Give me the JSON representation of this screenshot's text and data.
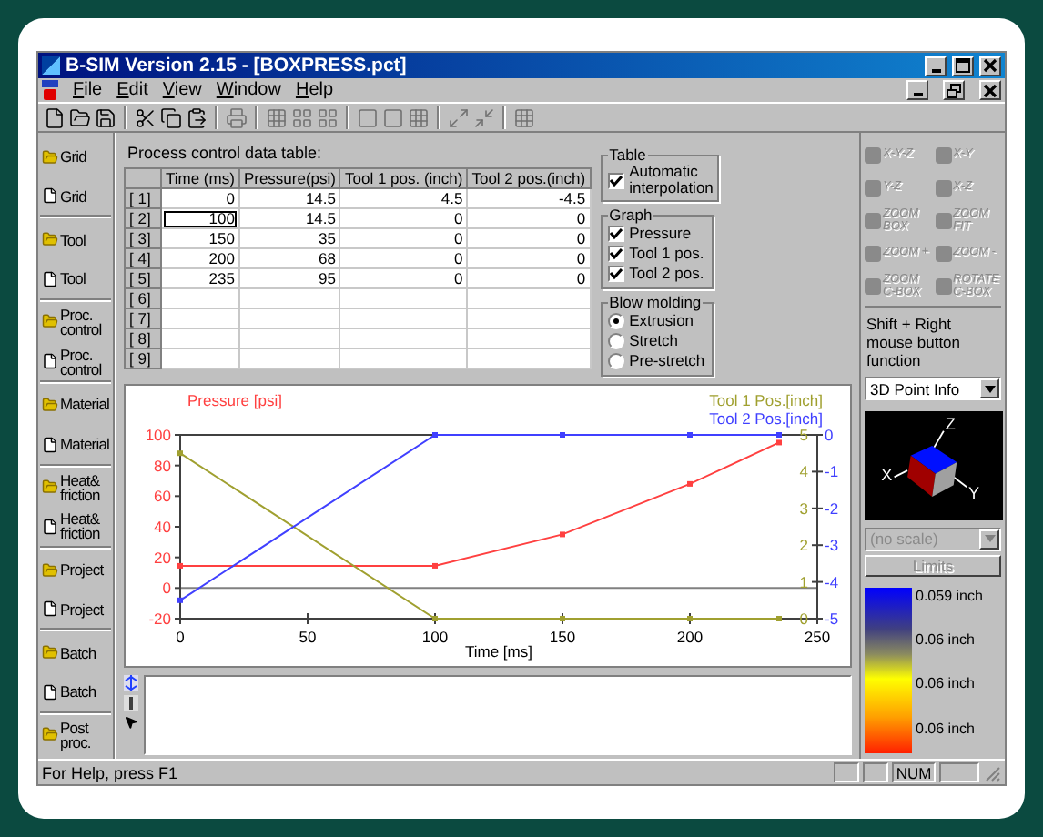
{
  "window": {
    "title": "B-SIM Version 2.15 - [BOXPRESS.pct]"
  },
  "menu": [
    "File",
    "Edit",
    "View",
    "Window",
    "Help"
  ],
  "sidebar": [
    {
      "label": "Grid",
      "kind": "open"
    },
    {
      "label": "Grid",
      "kind": "new"
    },
    {
      "label": "Tool",
      "kind": "open"
    },
    {
      "label": "Tool",
      "kind": "new"
    },
    {
      "label": "Proc. control",
      "kind": "open"
    },
    {
      "label": "Proc. control",
      "kind": "new"
    },
    {
      "label": "Material",
      "kind": "open"
    },
    {
      "label": "Material",
      "kind": "new"
    },
    {
      "label": "Heat& friction",
      "kind": "open"
    },
    {
      "label": "Heat& friction",
      "kind": "new"
    },
    {
      "label": "Project",
      "kind": "open"
    },
    {
      "label": "Project",
      "kind": "new"
    },
    {
      "label": "Batch",
      "kind": "open"
    },
    {
      "label": "Batch",
      "kind": "new"
    },
    {
      "label": "Post proc.",
      "kind": "open"
    }
  ],
  "table": {
    "title": "Process control data table:",
    "columns": [
      "Time (ms)",
      "Pressure(psi)",
      "Tool 1 pos. (inch)",
      "Tool 2 pos.(inch)"
    ],
    "rows": [
      {
        "label": "[ 1]",
        "cells": [
          {
            "text": "0",
            "focused": false
          },
          {
            "text": "14.5",
            "focused": false
          },
          {
            "text": "4.5",
            "focused": false
          },
          {
            "text": "-4.5",
            "focused": false
          }
        ]
      },
      {
        "label": "[ 2]",
        "cells": [
          {
            "text": "100",
            "focused": true
          },
          {
            "text": "14.5",
            "focused": false
          },
          {
            "text": "0",
            "focused": false
          },
          {
            "text": "0",
            "focused": false
          }
        ]
      },
      {
        "label": "[ 3]",
        "cells": [
          {
            "text": "150",
            "focused": false
          },
          {
            "text": "35",
            "focused": false
          },
          {
            "text": "0",
            "focused": false
          },
          {
            "text": "0",
            "focused": false
          }
        ]
      },
      {
        "label": "[ 4]",
        "cells": [
          {
            "text": "200",
            "focused": false
          },
          {
            "text": "68",
            "focused": false
          },
          {
            "text": "0",
            "focused": false
          },
          {
            "text": "0",
            "focused": false
          }
        ]
      },
      {
        "label": "[ 5]",
        "cells": [
          {
            "text": "235",
            "focused": false
          },
          {
            "text": "95",
            "focused": false
          },
          {
            "text": "0",
            "focused": false
          },
          {
            "text": "0",
            "focused": false
          }
        ]
      },
      {
        "label": "[ 6]",
        "cells": []
      },
      {
        "label": "[ 7]",
        "cells": []
      },
      {
        "label": "[ 8]",
        "cells": []
      },
      {
        "label": "[ 9]",
        "cells": []
      }
    ]
  },
  "groups": [
    {
      "title": "Table",
      "items": [
        {
          "kind": "checkbox",
          "label": "Automatic interpolation",
          "checked": true
        }
      ]
    },
    {
      "title": "Graph",
      "items": [
        {
          "kind": "checkbox",
          "label": "Pressure",
          "checked": true
        },
        {
          "kind": "checkbox",
          "label": "Tool 1 pos.",
          "checked": true
        },
        {
          "kind": "checkbox",
          "label": "Tool 2 pos.",
          "checked": true
        }
      ]
    },
    {
      "title": "Blow molding",
      "items": [
        {
          "kind": "radio",
          "label": "Extrusion",
          "selected": true
        },
        {
          "kind": "radio",
          "label": "Stretch",
          "selected": false
        },
        {
          "kind": "radio",
          "label": "Pre-stretch",
          "selected": false
        }
      ]
    }
  ],
  "chart": {
    "chart_data": {
      "type": "line",
      "xlabel": "Time [ms]",
      "x": [
        0,
        100,
        150,
        200,
        235
      ],
      "xlim": [
        0,
        250
      ],
      "ylim": [
        -20,
        100
      ],
      "xticks": [
        0,
        50,
        100,
        150,
        200,
        250
      ],
      "yticks": [
        -20,
        0,
        20,
        40,
        60,
        80,
        100
      ],
      "series": [
        {
          "name": "Pressure [psi]",
          "color": "#ff4040",
          "marker": "square",
          "values": [
            14.5,
            14.5,
            35,
            68,
            95
          ]
        },
        {
          "name": "Tool 1 Pos.[inch]",
          "color": "#a0a030",
          "marker": "square",
          "axis": "y2",
          "values": [
            4.5,
            0,
            0,
            0,
            0
          ]
        },
        {
          "name": "Tool 2 Pos.[inch]",
          "color": "#4040ff",
          "marker": "square",
          "axis": "y3",
          "values": [
            -4.5,
            0,
            0,
            0,
            0
          ]
        }
      ],
      "y2lim": [
        0,
        5
      ],
      "y2ticks": [
        0,
        1,
        2,
        3,
        4,
        5
      ],
      "y3lim": [
        -5,
        0
      ],
      "y3ticks": [
        -5,
        -4,
        -3,
        -2,
        -1,
        0
      ]
    }
  },
  "view_buttons": [
    {
      "label": "X-Y-Z",
      "disabled": true
    },
    {
      "label": "X-Y",
      "disabled": true
    },
    {
      "label": "Y-Z",
      "disabled": true
    },
    {
      "label": "X-Z",
      "disabled": true
    },
    {
      "label": "ZOOM BOX",
      "disabled": true
    },
    {
      "label": "ZOOM FIT",
      "disabled": true
    },
    {
      "label": "ZOOM +",
      "disabled": true
    },
    {
      "label": "ZOOM -",
      "disabled": true
    },
    {
      "label": "ZOOM C-BOX",
      "disabled": true
    },
    {
      "label": "ROTATE C-BOX",
      "disabled": true
    }
  ],
  "mouse_function": {
    "label": "Shift + Right mouse button function",
    "value": "3D Point Info"
  },
  "view3d": {
    "axis_labels": [
      "Z",
      "X",
      "Y"
    ]
  },
  "scale": {
    "value": "(no scale)",
    "disabled": true,
    "limits": {
      "label": "Limits",
      "disabled": true
    },
    "labels": [
      "0.059 inch",
      "0.06 inch",
      "0.06 inch",
      "0.06 inch"
    ]
  },
  "status_bar": {
    "text": "For Help, press F1",
    "indicators": [
      "NUM"
    ]
  }
}
